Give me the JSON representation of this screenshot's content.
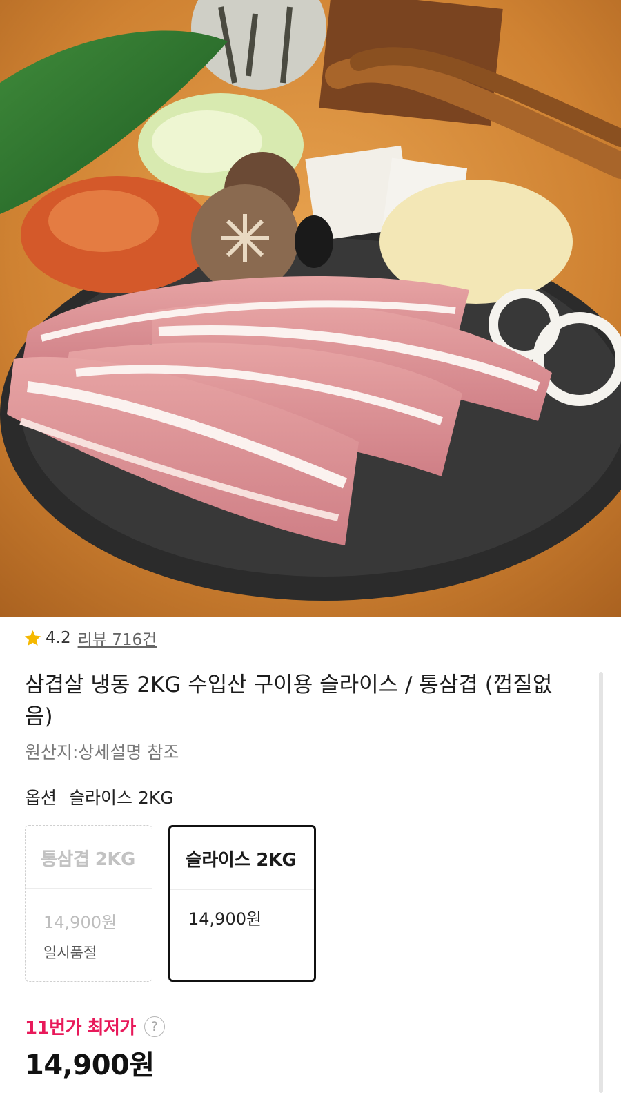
{
  "product": {
    "rating": "4.2",
    "review_link": "리뷰 716건",
    "title": "삼겹살 냉동 2KG 수입산 구이용 슬라이스 / 통삼겹 (껍질없음)",
    "origin": "원산지:상세설명 참조"
  },
  "options": {
    "label": "옵션",
    "selected_value": "슬라이스 2KG",
    "items": [
      {
        "name": "통삼겹 2KG",
        "price": "14,900원",
        "status": "일시품절"
      },
      {
        "name": "슬라이스 2KG",
        "price": "14,900원",
        "status": ""
      }
    ]
  },
  "pricing": {
    "lowest_label": "11번가 최저가",
    "help_icon_glyph": "?",
    "final_price": "14,900원"
  },
  "colors": {
    "accent": "#e8195a",
    "star": "#f5b800",
    "selected_border": "#111111"
  },
  "icons": [
    "star-icon",
    "help-icon"
  ]
}
